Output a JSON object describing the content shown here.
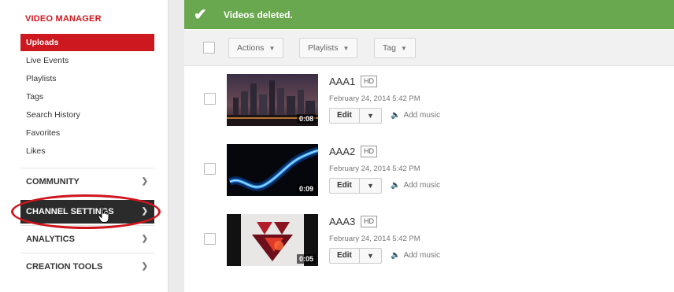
{
  "sidebar": {
    "title": "VIDEO MANAGER",
    "items": [
      {
        "label": "Uploads",
        "active": true
      },
      {
        "label": "Live Events"
      },
      {
        "label": "Playlists"
      },
      {
        "label": "Tags"
      },
      {
        "label": "Search History"
      },
      {
        "label": "Favorites"
      },
      {
        "label": "Likes"
      }
    ],
    "sections": [
      {
        "label": "COMMUNITY",
        "icon": "chevron-down-icon"
      },
      {
        "label": "CHANNEL SETTINGS",
        "icon": "chevron-down-icon",
        "hovered": true
      },
      {
        "label": "ANALYTICS",
        "icon": "chevron-down-icon"
      },
      {
        "label": "CREATION TOOLS",
        "icon": "chevron-down-icon"
      }
    ]
  },
  "banner": {
    "icon": "checkmark-icon",
    "message": "Videos deleted.",
    "color": "#6aa84f"
  },
  "toolbar": {
    "actions_label": "Actions",
    "playlists_label": "Playlists",
    "tag_label": "Tag"
  },
  "videos": [
    {
      "title": "AAA1",
      "badge": "HD",
      "date": "February 24, 2014 5:42 PM",
      "duration": "0:08",
      "edit_label": "Edit",
      "music_label": "Add music"
    },
    {
      "title": "AAA2",
      "badge": "HD",
      "date": "February 24, 2014 5:42 PM",
      "duration": "0:09",
      "edit_label": "Edit",
      "music_label": "Add music"
    },
    {
      "title": "AAA3",
      "badge": "HD",
      "date": "February 24, 2014 5:42 PM",
      "duration": "0:05",
      "edit_label": "Edit",
      "music_label": "Add music"
    }
  ],
  "colors": {
    "brand_red": "#cc181e",
    "dark_section": "#2b2b2b",
    "highlight_ring": "#d0141c"
  }
}
